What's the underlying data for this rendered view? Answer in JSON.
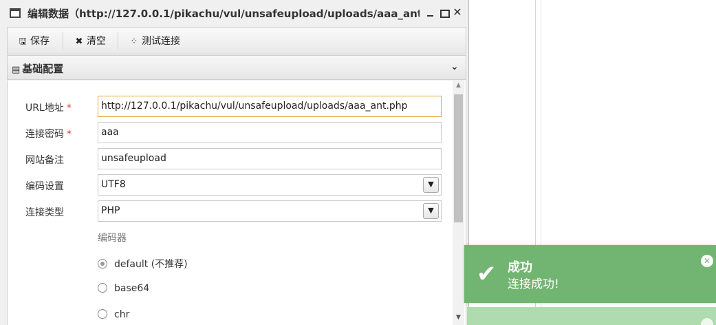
{
  "window": {
    "title": "编辑数据（http://127.0.0.1/pikachu/vul/unsafeupload/uploads/aaa_ant...",
    "close_glyph": "✕"
  },
  "toolbar": {
    "save_label": "保存",
    "clear_label": "清空",
    "test_label": "测试连接",
    "save_icon": "save-icon",
    "clear_icon": "close-icon",
    "test_icon": "spinner-icon"
  },
  "section": {
    "title": "基础配置",
    "collapsed": false
  },
  "form": {
    "url": {
      "label": "URL地址",
      "required_mark": "*",
      "value": "http://127.0.0.1/pikachu/vul/unsafeupload/uploads/aaa_ant.php"
    },
    "password": {
      "label": "连接密码",
      "required_mark": "*",
      "value": "aaa"
    },
    "note": {
      "label": "网站备注",
      "value": "unsafeupload"
    },
    "encoding": {
      "label": "编码设置",
      "value": "UTF8"
    },
    "type": {
      "label": "连接类型",
      "value": "PHP"
    },
    "encoder": {
      "label": "编码器",
      "options": [
        {
          "label": "default (不推荐)",
          "checked": true
        },
        {
          "label": "base64",
          "checked": false
        },
        {
          "label": "chr",
          "checked": false
        }
      ]
    }
  },
  "toast": {
    "title": "成功",
    "message": "连接成功!",
    "close_glyph": "✕",
    "color": "#72b472"
  },
  "colors": {
    "focus_border": "#e6a43b",
    "required": "#e33333"
  }
}
